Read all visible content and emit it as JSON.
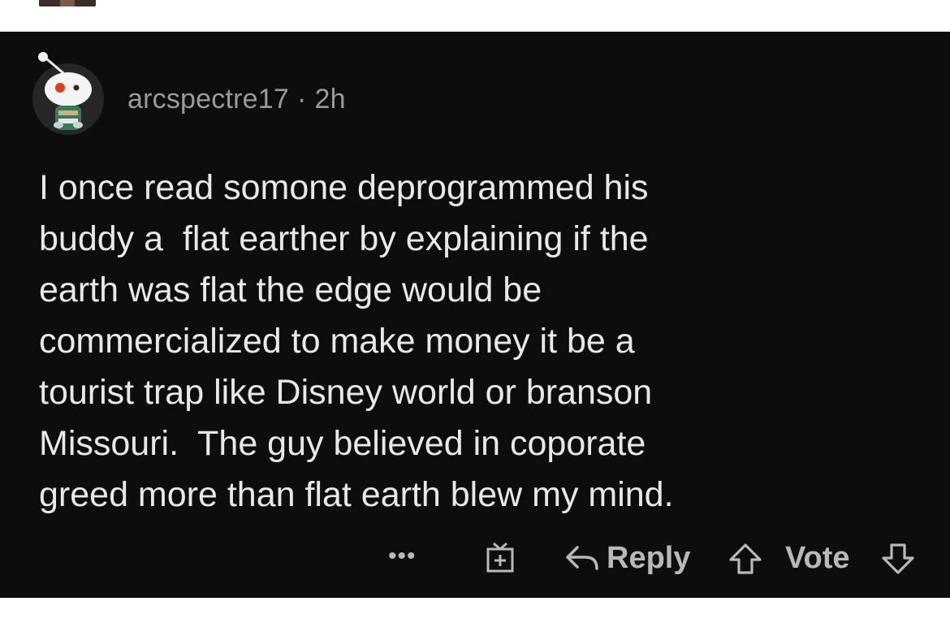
{
  "comment": {
    "author": "arcspectre17",
    "separator": "·",
    "age": "2h",
    "body": "I once read somone deprogrammed his\nbuddy a  flat earther by explaining if the\nearth was flat the edge would be\ncommercialized to make money it be a\ntourist trap like Disney world or branson\nMissouri.  The guy believed in coporate\ngreed more than flat earth blew my mind."
  },
  "actions": {
    "more_label": "•••",
    "reply_label": "Reply",
    "vote_label": "Vote"
  },
  "icons": {
    "avatar": "reddit-snoo-avatar",
    "award": "award-gift-icon",
    "reply": "reply-arrow-icon",
    "upvote": "upvote-arrow-icon",
    "downvote": "downvote-arrow-icon"
  },
  "colors": {
    "background": "#0d0d0d",
    "body_text": "#e8e8e8",
    "meta_text": "#9a9a9a",
    "action_text": "#b8b8b8"
  }
}
